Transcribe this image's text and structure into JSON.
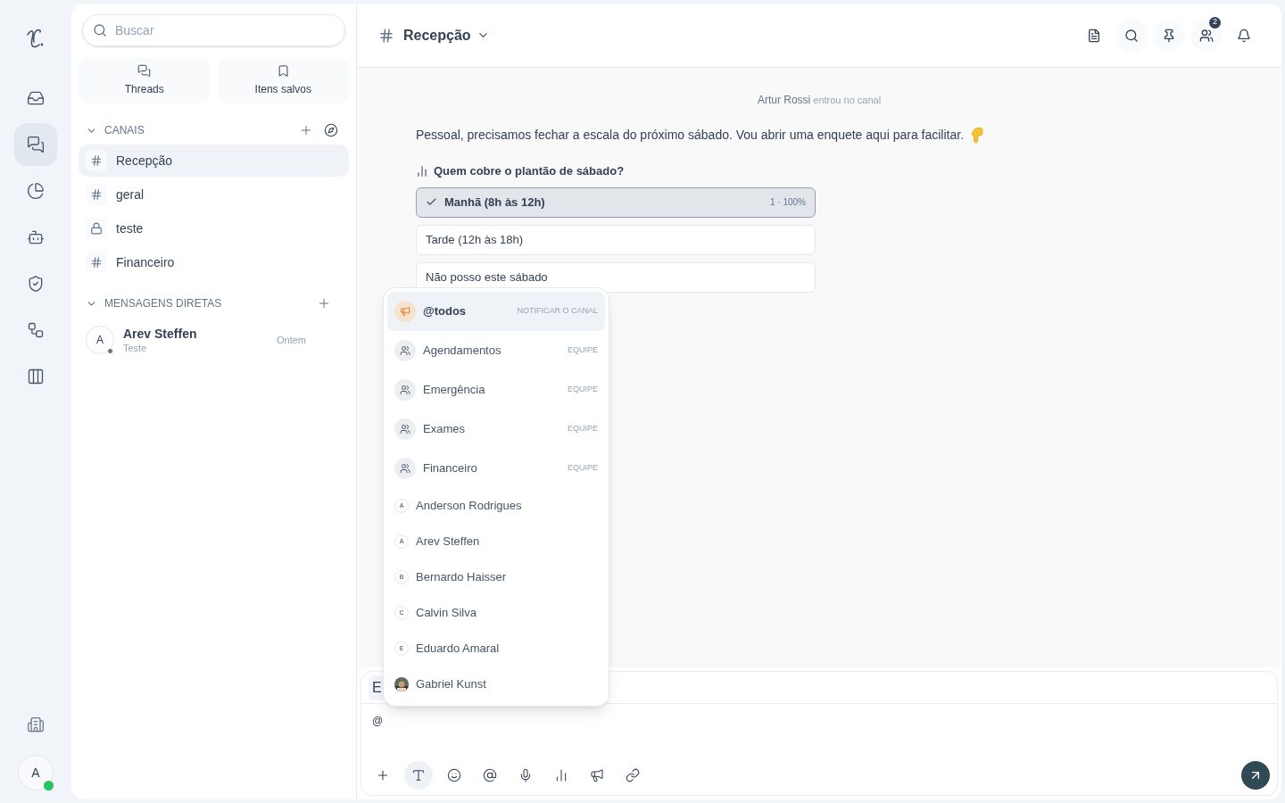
{
  "rail": [
    {
      "kind": "inbox",
      "selected": false
    },
    {
      "kind": "chats",
      "selected": true
    },
    {
      "kind": "reports",
      "selected": false
    },
    {
      "kind": "bot",
      "selected": false
    },
    {
      "kind": "security",
      "selected": false
    },
    {
      "kind": "flows",
      "selected": false
    },
    {
      "kind": "boards",
      "selected": false
    }
  ],
  "rail_bottom": {
    "avatar": "A",
    "online": true
  },
  "sidebar": {
    "search_placeholder": "Buscar",
    "shortcuts": [
      {
        "kind": "threads",
        "label": "Threads"
      },
      {
        "kind": "saved",
        "label": "Itens salvos"
      }
    ],
    "channels_title": "CANAIS",
    "channels_expanded": true,
    "channels": [
      {
        "name": "Recepção",
        "kind": "public",
        "selected": true
      },
      {
        "name": "geral",
        "kind": "public",
        "selected": false
      },
      {
        "name": "teste",
        "kind": "private",
        "selected": false
      },
      {
        "name": "Financeiro",
        "kind": "public",
        "selected": false
      }
    ],
    "dm_title": "MENSAGENS DIRETAS",
    "dm_expanded": true,
    "direct_messages": [
      {
        "avatar": "A",
        "name": "Arev Steffen",
        "preview": "Teste",
        "time": "Ontem",
        "online": false
      }
    ]
  },
  "header": {
    "channel": "Recepção",
    "members_badge": "2"
  },
  "messages": [
    {
      "kind": "system",
      "text": "**Artur Rossi** entrou no canal"
    },
    {
      "kind": "text",
      "text": "Pessoal, precisamos fechar a escala do próximo sábado. Vou abrir uma enquete aqui para facilitar."
    }
  ],
  "poll": {
    "question": "Quem cobre o plantão de sábado?",
    "options": [
      {
        "label": "Manhã (8h às 12h)",
        "selected": true,
        "result": "1 · 100%"
      },
      {
        "label": "Tarde (12h às 18h)",
        "selected": false
      },
      {
        "label": "Não posso este sábado",
        "selected": false
      }
    ]
  },
  "mention_menu": [
    {
      "kind": "everyone",
      "name": "@todos",
      "tag": "NOTIFICAR O CANAL",
      "selected": true
    },
    {
      "kind": "team",
      "name": "Agendamentos",
      "tag": "EQUIPE",
      "selected": false
    },
    {
      "kind": "team",
      "name": "Emergência",
      "tag": "EQUIPE",
      "selected": false
    },
    {
      "kind": "team",
      "name": "Exames",
      "tag": "EQUIPE",
      "selected": false
    },
    {
      "kind": "team",
      "name": "Financeiro",
      "tag": "EQUIPE",
      "selected": false
    },
    {
      "kind": "user",
      "initial": "A",
      "name": "Anderson Rodrigues",
      "selected": false
    },
    {
      "kind": "user",
      "initial": "A",
      "name": "Arev Steffen",
      "selected": false
    },
    {
      "kind": "user",
      "initial": "B",
      "name": "Bernardo Haisser",
      "selected": false
    },
    {
      "kind": "user",
      "initial": "C",
      "name": "Calvin Silva",
      "selected": false
    },
    {
      "kind": "user",
      "initial": "E",
      "name": "Eduardo Amaral",
      "selected": false
    },
    {
      "name": "Gabriel Kunst",
      "selected": false
    }
  ],
  "composer": {
    "chip": "E",
    "value": "@",
    "tools": [
      {
        "kind": "plus",
        "selected": false
      },
      {
        "kind": "format",
        "selected": true
      },
      {
        "kind": "emoji",
        "selected": false
      },
      {
        "kind": "mention",
        "selected": false
      },
      {
        "kind": "mic",
        "selected": false
      },
      {
        "kind": "poll",
        "selected": false
      },
      {
        "kind": "announce",
        "selected": false
      },
      {
        "kind": "link",
        "selected": false
      }
    ]
  }
}
